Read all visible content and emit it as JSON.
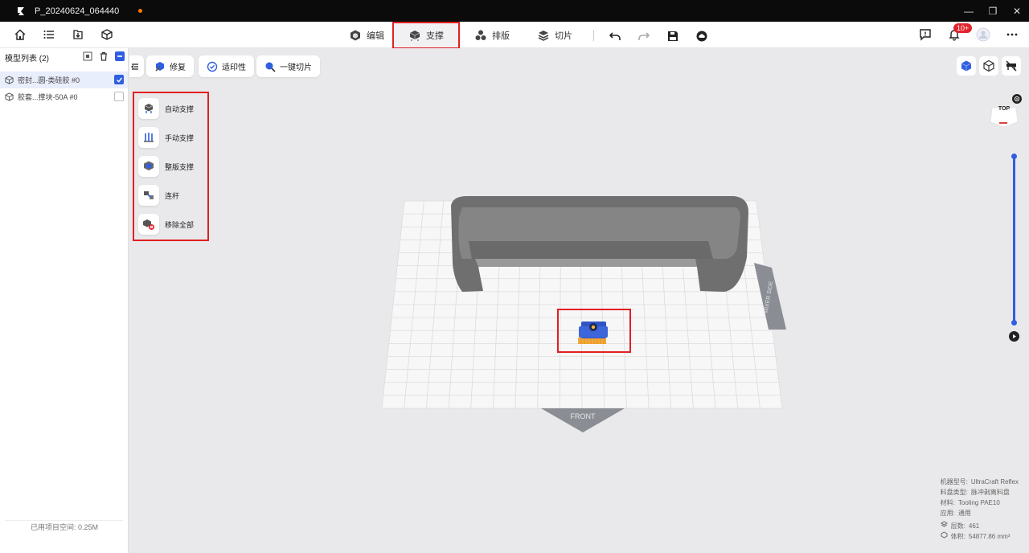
{
  "titlebar": {
    "filename": "P_20240624_064440",
    "controls": {
      "minimize": "—",
      "restore": "❐",
      "close": "✕"
    }
  },
  "toolbar": {
    "modes": [
      {
        "label": "编辑",
        "icon": "edit-cube-icon"
      },
      {
        "label": "支撑",
        "icon": "support-icon",
        "selected": true
      },
      {
        "label": "排版",
        "icon": "arrange-icon"
      },
      {
        "label": "切片",
        "icon": "slice-icon"
      }
    ],
    "notification_badge": "10+"
  },
  "model_list": {
    "title": "模型列表 (2)",
    "items": [
      {
        "name": "密封...圆-类硅胶 #0",
        "checked": true
      },
      {
        "name": "胶套...撑块-50A #0",
        "checked": false
      }
    ],
    "footer": "已用项目空间: 0.25M"
  },
  "viewport_toolbar": {
    "repair": "修复",
    "printability": "适印性",
    "one_click_slice": "一键切片"
  },
  "support_panel": {
    "items": [
      {
        "label": "自动支撑",
        "icon": "auto-support-icon"
      },
      {
        "label": "手动支撑",
        "icon": "manual-support-icon"
      },
      {
        "label": "整版支撑",
        "icon": "plate-support-icon"
      },
      {
        "label": "连杆",
        "icon": "connector-rod-icon"
      },
      {
        "label": "移除全部",
        "icon": "remove-all-icon"
      }
    ]
  },
  "scene": {
    "front_label": "FRONT",
    "side_label": "MIXER SIDE",
    "view_cube_label": "TOP"
  },
  "info": {
    "machine_label": "机器型号:",
    "machine": "UltraCraft Reflex",
    "tray_label": "料盘类型:",
    "tray": "脉冲剥离料盘",
    "material_label": "材料:",
    "material": "Tooling PAE10",
    "application_label": "应用:",
    "application": "通用",
    "layers_label": "层数:",
    "layers": "461",
    "volume_label": "体积:",
    "volume": "54877.86 mm³"
  },
  "colors": {
    "accent": "#2f5fe0",
    "highlight_border": "#e02020",
    "model_gray": "#7a7a7a",
    "plate": "#f7f7f7"
  }
}
